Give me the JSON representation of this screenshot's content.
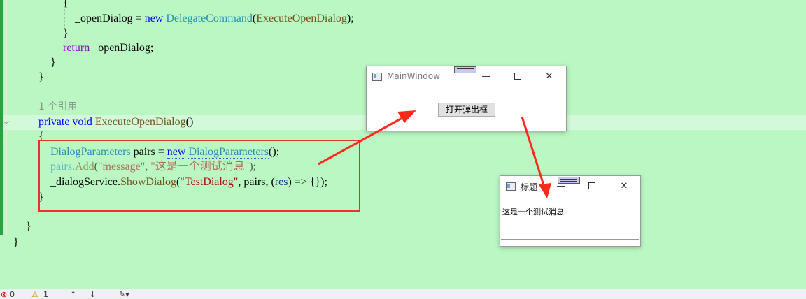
{
  "code": {
    "line1": "{",
    "line2_var": "_openDialog",
    "line2_eq": " = ",
    "line2_new": "new",
    "line2_type": "DelegateCommand",
    "line2_paren_open": "(",
    "line2_arg": "ExecuteOpenDialog",
    "line2_end": ");",
    "line3": "}",
    "line4_kw": "return",
    "line4_rest": " _openDialog;",
    "line5": "}",
    "line6": "}",
    "ref_count": "1 个引用",
    "line7_kw1": "private",
    "line7_kw2": "void",
    "line7_meth": "ExecuteOpenDialog",
    "line7_parens": "()",
    "line8": "{",
    "line9_type": "DialogParameters",
    "line9_var": " pairs = ",
    "line9_new": "new",
    "line9_type2": "DialogParameters",
    "line9_end": "();",
    "line10_obj": "pairs.",
    "line10_meth": "Add",
    "line10_open": "(",
    "line10_str1": "\"message\"",
    "line10_comma": ", ",
    "line10_str2": "\"这是一个测试消息\"",
    "line10_end": ");",
    "line11_obj": "_dialogService.",
    "line11_meth": "ShowDialog",
    "line11_open": "(",
    "line11_str": "\"TestDialog\"",
    "line11_mid": ", pairs, (",
    "line11_res": "res",
    "line11_end": ") => {});",
    "line12": "}",
    "line13": "}",
    "line14": "}"
  },
  "main_window": {
    "title": "MainWindow",
    "button_label": "打开弹出框",
    "minimize": "—",
    "close": "✕"
  },
  "dialog_window": {
    "title": "标题",
    "message": "这是一个测试消息",
    "minimize": "—",
    "close": "✕"
  },
  "status_bar": {
    "errors": "0",
    "warnings": "1"
  },
  "colors": {
    "editor_bg": "#baf7c3",
    "highlight_box": "#e8322b",
    "arrow": "#ff2a1a"
  }
}
